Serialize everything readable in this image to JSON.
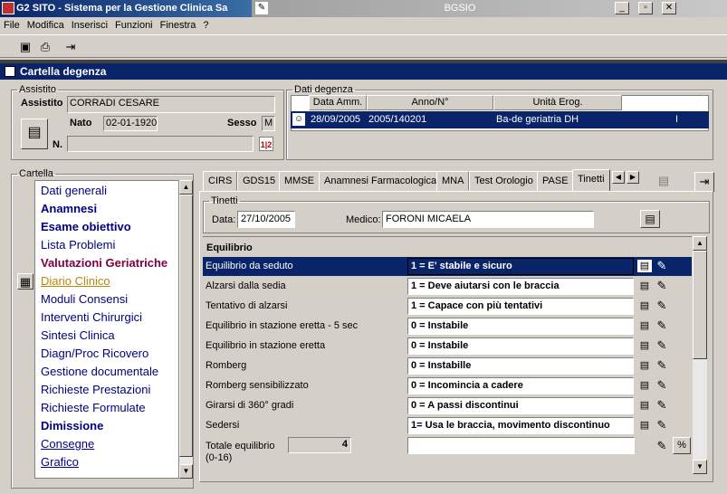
{
  "window": {
    "app_title": "G2 SITO - Sistema per la Gestione Clinica Sa",
    "doc_title": "BGSIO",
    "min": "_",
    "max": "▫",
    "close": "✕"
  },
  "menu": [
    "File",
    "Modifica",
    "Inserisci",
    "Funzioni",
    "Finestra",
    "?"
  ],
  "card_title": "Cartella degenza",
  "assistito": {
    "legend": "Assistito",
    "name_label": "Assistito",
    "name_value": "CORRADI CESARE",
    "nato_label": "Nato",
    "nato_value": "02-01-1920",
    "sesso_label": "Sesso",
    "sesso_value": "M",
    "n_label": "N.",
    "n_value": ""
  },
  "dati_degenza": {
    "legend": "Dati degenza",
    "headers": [
      "Data Amm.",
      "Anno/N°",
      "Unità Erog."
    ],
    "row": {
      "data_amm": "28/09/2005",
      "anno_n": "2005/140201",
      "unita": "Ba-de geriatria DH",
      "extra": "I"
    }
  },
  "cartella": {
    "legend": "Cartella",
    "items": [
      {
        "label": "Dati generali"
      },
      {
        "label": "Anamnesi"
      },
      {
        "label": "Esame obiettivo"
      },
      {
        "label": "Lista Problemi"
      },
      {
        "label": "Valutazioni Geriatriche"
      },
      {
        "label": "Diario Clinico"
      },
      {
        "label": "Moduli Consensi"
      },
      {
        "label": "Interventi Chirurgici"
      },
      {
        "label": "Sintesi Clinica"
      },
      {
        "label": "Diagn/Proc Ricovero"
      },
      {
        "label": "Gestione documentale"
      },
      {
        "label": "Richieste Prestazioni"
      },
      {
        "label": "Richieste Formulate"
      },
      {
        "label": "Dimissione"
      },
      {
        "label": "Consegne"
      },
      {
        "label": "Grafico"
      }
    ]
  },
  "tabs": [
    "CIRS",
    "GDS15",
    "MMSE",
    "Anamnesi Farmacologica",
    "MNA",
    "Test Orologio",
    "PASE",
    "Tinetti"
  ],
  "tinetti": {
    "legend": "Tinetti",
    "data_label": "Data:",
    "data_value": "27/10/2005",
    "medico_label": "Medico:",
    "medico_value": "FORONI MICAELA",
    "section_title": "Equilibrio",
    "rows": [
      {
        "name": "Equilibrio da seduto",
        "value": "1 = E' stabile e sicuro"
      },
      {
        "name": "Alzarsi dalla sedia",
        "value": "1 = Deve aiutarsi con le braccia"
      },
      {
        "name": "Tentativo di alzarsi",
        "value": "1 = Capace con più tentativi"
      },
      {
        "name": "Equilibrio in stazione eretta - 5 sec",
        "value": "0 = Instabile"
      },
      {
        "name": "Equilibrio in stazione eretta",
        "value": "0 = Instabile"
      },
      {
        "name": "Romberg",
        "value": "0 = Instabille"
      },
      {
        "name": "Romberg sensibilizzato",
        "value": "0 = Incomincia a cadere"
      },
      {
        "name": "Girarsi di 360° gradi",
        "value": "0 = A passi discontinui"
      },
      {
        "name": "Sedersi",
        "value": "1= Usa le braccia, movimento discontinuo"
      }
    ],
    "totale_label_1": "Totale equilibrio",
    "totale_label_2": "(0-16)",
    "totale_value": "4",
    "totale_text": "",
    "percent_label": "%"
  }
}
